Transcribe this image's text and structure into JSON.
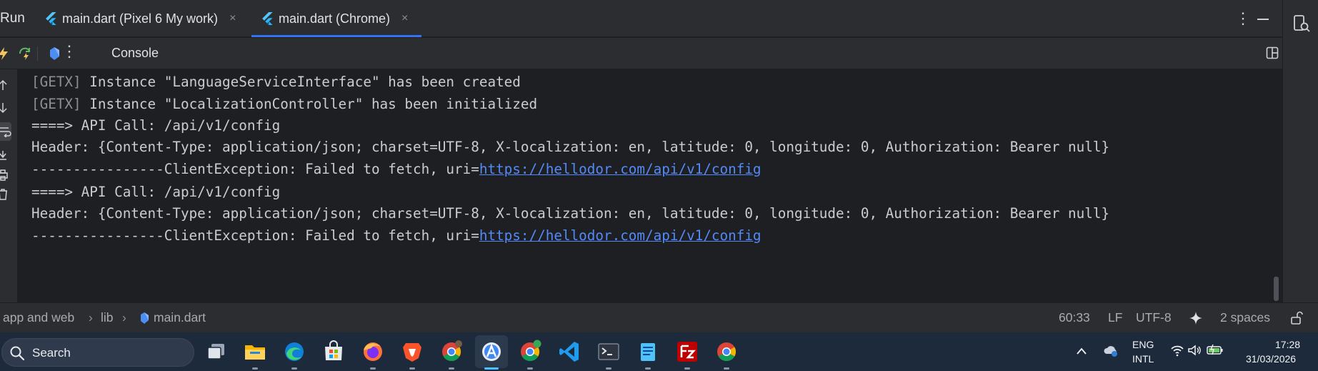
{
  "run_window": {
    "title": "Run",
    "tabs": [
      {
        "label": "main.dart (Pixel 6 My work)",
        "close": "×"
      },
      {
        "label": "main.dart (Chrome)",
        "close": "×"
      }
    ],
    "more_glyph": "⋮"
  },
  "toolbar": {
    "more_glyph": "⋮",
    "console_tab": "Console"
  },
  "console": {
    "lines": [
      {
        "tag": "[GETX]",
        "text": " Instance \"LanguageServiceInterface\" has been created"
      },
      {
        "tag": "[GETX]",
        "text": " Instance \"LocalizationController\" has been initialized"
      },
      {
        "text": "====> API Call: /api/v1/config"
      },
      {
        "text": "Header: {Content-Type: application/json; charset=UTF-8, X-localization: en, latitude: 0, longitude: 0, Authorization: Bearer null}"
      },
      {
        "text": "----------------ClientException: Failed to fetch, uri=",
        "link": "https://hellodor.com/api/v1/config"
      },
      {
        "text": "====> API Call: /api/v1/config"
      },
      {
        "text": "Header: {Content-Type: application/json; charset=UTF-8, X-localization: en, latitude: 0, longitude: 0, Authorization: Bearer null}"
      },
      {
        "text": "----------------ClientException: Failed to fetch, uri=",
        "link": "https://hellodor.com/api/v1/config"
      }
    ]
  },
  "status_bar": {
    "breadcrumb": [
      "app and web",
      "lib",
      "main.dart"
    ],
    "separator": "›",
    "caret_position": "60:33",
    "line_separator": "LF",
    "encoding": "UTF-8",
    "indent": "2 spaces"
  },
  "taskbar": {
    "search_placeholder": "Search",
    "apps": [
      "task-view",
      "file-explorer",
      "edge",
      "microsoft-store",
      "firefox",
      "brave",
      "chrome-profile",
      "android-studio",
      "chrome-dev",
      "vscode",
      "terminal",
      "notepad",
      "filezilla",
      "chrome"
    ],
    "tray": {
      "language_top": "ENG",
      "language_bottom": "INTL",
      "time": "17:28",
      "date": "31/03/2026"
    }
  },
  "colors": {
    "editor_bg": "#1e1f22",
    "panel_bg": "#2b2d30",
    "accent": "#3574f0",
    "link": "#548af7",
    "taskbar_bg": "#1d2a3b"
  }
}
